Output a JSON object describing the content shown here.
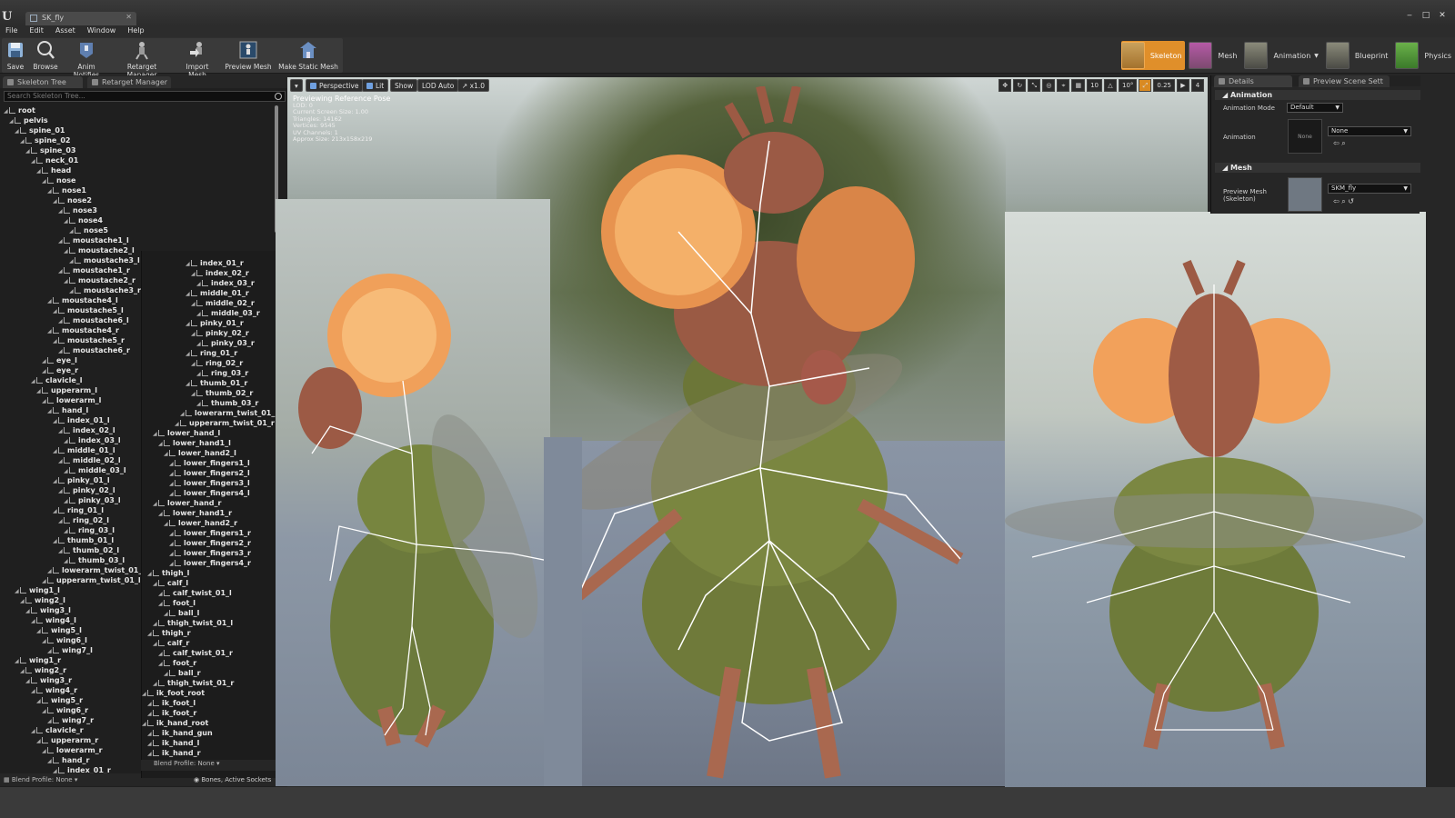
{
  "window": {
    "tab_title": "SK_fly",
    "controls": [
      "‒",
      "□",
      "✕"
    ]
  },
  "menu": [
    "File",
    "Edit",
    "Asset",
    "Window",
    "Help"
  ],
  "toolbar": {
    "buttons": [
      "Save",
      "Browse",
      "Anim Notifies",
      "Retarget Manager",
      "Import Mesh",
      "Preview Mesh",
      "Make Static Mesh"
    ]
  },
  "modes": [
    "Skeleton",
    "Mesh",
    "Animation",
    "Blueprint",
    "Physics"
  ],
  "left_panel": {
    "tabs": [
      "Skeleton Tree",
      "Retarget Manager"
    ],
    "search_placeholder": "Search Skeleton Tree...",
    "blend_profile": "Blend Profile: None",
    "bones_filter": "Bones, Active Sockets",
    "tree1": [
      "root",
      "pelvis",
      "spine_01",
      "spine_02",
      "spine_03",
      "neck_01",
      "head",
      "nose",
      "nose1",
      "nose2",
      "nose3",
      "nose4",
      "nose5",
      "moustache1_l",
      "moustache2_l",
      "moustache3_l",
      "moustache1_r",
      "moustache2_r",
      "moustache3_r",
      "moustache4_l",
      "moustache5_l",
      "moustache6_l",
      "moustache4_r",
      "moustache5_r",
      "moustache6_r",
      "eye_l",
      "eye_r",
      "clavicle_l",
      "upperarm_l",
      "lowerarm_l",
      "hand_l",
      "index_01_l",
      "index_02_l",
      "index_03_l",
      "middle_01_l",
      "middle_02_l",
      "middle_03_l",
      "pinky_01_l",
      "pinky_02_l",
      "pinky_03_l",
      "ring_01_l",
      "ring_02_l",
      "ring_03_l",
      "thumb_01_l",
      "thumb_02_l",
      "thumb_03_l",
      "lowerarm_twist_01_l",
      "upperarm_twist_01_l",
      "wing1_l",
      "wing2_l",
      "wing3_l",
      "wing4_l",
      "wing5_l",
      "wing6_l",
      "wing7_l",
      "wing1_r",
      "wing2_r",
      "wing3_r",
      "wing4_r",
      "wing5_r",
      "wing6_r",
      "wing7_r",
      "clavicle_r",
      "upperarm_r",
      "lowerarm_r",
      "hand_r",
      "index_01_r"
    ],
    "tree2": [
      "index_01_r",
      "index_02_r",
      "index_03_r",
      "middle_01_r",
      "middle_02_r",
      "middle_03_r",
      "pinky_01_r",
      "pinky_02_r",
      "pinky_03_r",
      "ring_01_r",
      "ring_02_r",
      "ring_03_r",
      "thumb_01_r",
      "thumb_02_r",
      "thumb_03_r",
      "lowerarm_twist_01_r",
      "upperarm_twist_01_r",
      "lower_hand_l",
      "lower_hand1_l",
      "lower_hand2_l",
      "lower_fingers1_l",
      "lower_fingers2_l",
      "lower_fingers3_l",
      "lower_fingers4_l",
      "lower_hand_r",
      "lower_hand1_r",
      "lower_hand2_r",
      "lower_fingers1_r",
      "lower_fingers2_r",
      "lower_fingers3_r",
      "lower_fingers4_r",
      "thigh_l",
      "calf_l",
      "calf_twist_01_l",
      "foot_l",
      "ball_l",
      "thigh_twist_01_l",
      "thigh_r",
      "calf_r",
      "calf_twist_01_r",
      "foot_r",
      "ball_r",
      "thigh_twist_01_r",
      "ik_foot_root",
      "ik_foot_l",
      "ik_foot_r",
      "ik_hand_root",
      "ik_hand_gun",
      "ik_hand_l",
      "ik_hand_r"
    ]
  },
  "viewport": {
    "buttons": [
      "Perspective",
      "Lit",
      "Show",
      "LOD Auto",
      "x1.0"
    ],
    "info_title": "Previewing Reference Pose",
    "info_lines": [
      "LOD: 0",
      "Current Screen Size: 1.00",
      "Triangles: 14162",
      "Vertices: 9545",
      "UV Channels: 1",
      "Approx Size: 213x158x219"
    ],
    "tools": [
      "10",
      "10°",
      "0.25",
      "4"
    ]
  },
  "details": {
    "tabs": [
      "Details",
      "Preview Scene Sett"
    ],
    "animation_section": "Animation",
    "animation_mode_label": "Animation Mode",
    "animation_mode_value": "Default",
    "animation_label": "Animation",
    "animation_value": "None",
    "animation_thumb": "None",
    "mesh_section": "Mesh",
    "preview_mesh_label": "Preview Mesh (Skeleton)",
    "preview_mesh_value": "SKM_fly"
  }
}
